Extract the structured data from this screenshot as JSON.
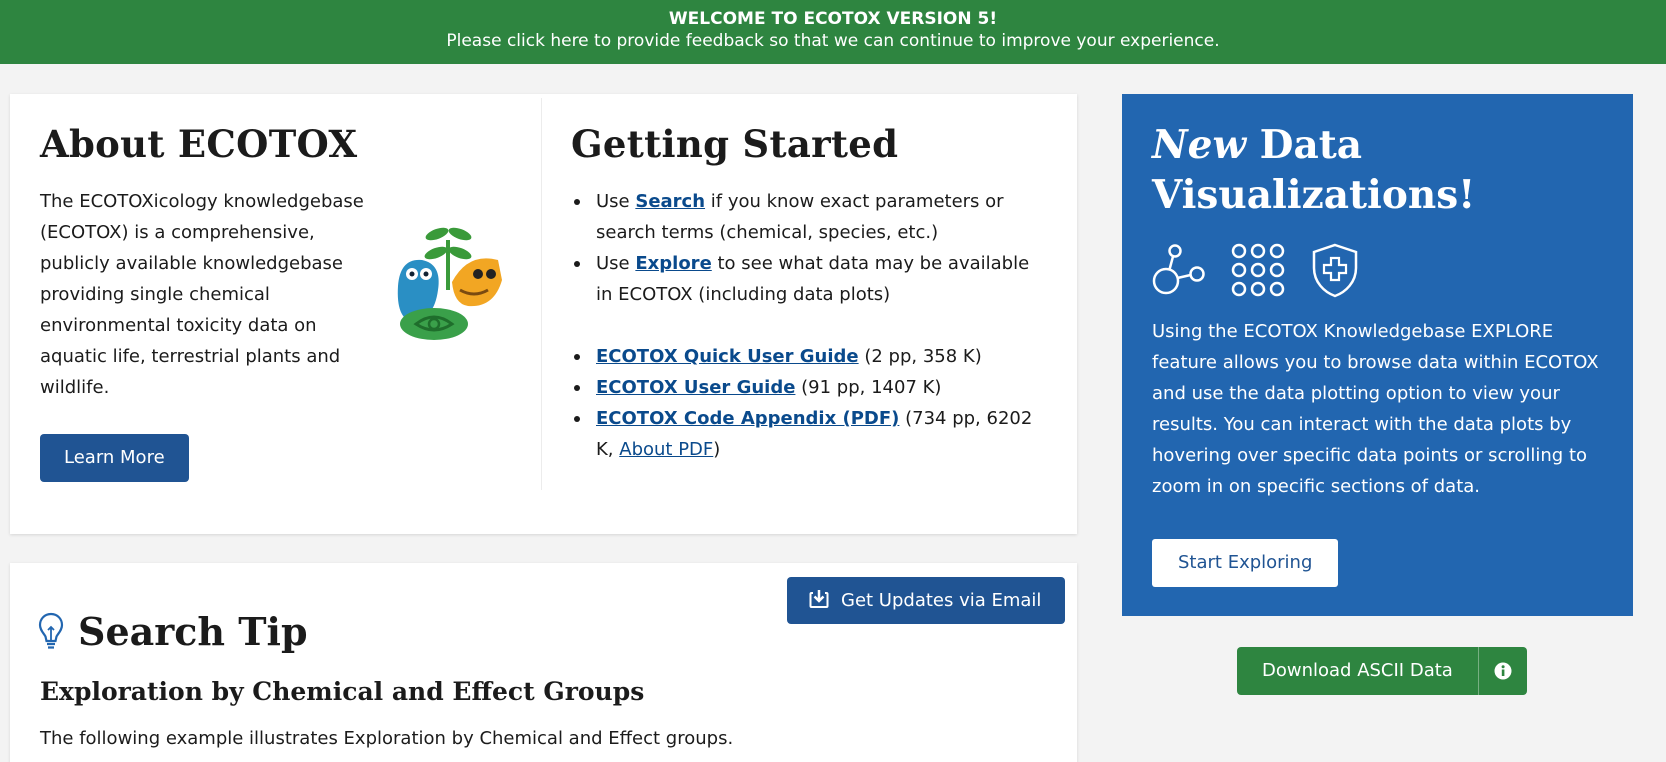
{
  "banner": {
    "line1": "WELCOME TO ECOTOX VERSION 5!",
    "line2": "Please click here to provide feedback so that we can continue to improve your experience."
  },
  "about": {
    "title": "About ECOTOX",
    "text": "The ECOTOXicology knowledgebase (ECOTOX) is a comprehensive, publicly available knowledgebase providing single chemical environmental toxicity data on aquatic life, terrestrial plants and wildlife.",
    "button": "Learn More"
  },
  "getting_started": {
    "title": "Getting Started",
    "items": [
      {
        "prefix": "Use ",
        "link": "Search",
        "suffix": " if you know exact parameters or search terms (chemical, species, etc.)"
      },
      {
        "prefix": "Use ",
        "link": "Explore",
        "suffix": " to see what data may be available in ECOTOX (including data plots)"
      }
    ],
    "guides": [
      {
        "link": "ECOTOX Quick User Guide",
        "detail": " (2 pp, 358 K)"
      },
      {
        "link": "ECOTOX User Guide",
        "detail": " (91 pp, 1407 K)"
      },
      {
        "link": "ECOTOX Code Appendix (PDF)",
        "detail": " (734 pp, 6202 K, ",
        "link2": "About PDF",
        "close": ")"
      }
    ]
  },
  "search_tip": {
    "title": "Search Tip",
    "subtitle": "Exploration by Chemical and Effect Groups",
    "text": "The following example illustrates Exploration by Chemical and Effect groups.",
    "updates_button": "Get Updates via Email"
  },
  "viz": {
    "title_em": "New",
    "title_rest": " Data",
    "title_line2": "Visualizations!",
    "icons": [
      "network-graph-icon",
      "dot-grid-icon",
      "shield-plus-icon"
    ],
    "text": "Using the ECOTOX Knowledgebase EXPLORE feature allows you to browse data within ECOTOX and use the data plotting option to view your results. You can interact with the data plots by hovering over specific data points or scrolling to zoom in on specific sections of data.",
    "button": "Start Exploring"
  },
  "download": {
    "button": "Download ASCII Data"
  },
  "colors": {
    "banner_green": "#2e8540",
    "primary_blue": "#205493",
    "viz_blue": "#2266b0",
    "link_blue": "#0a4a8c"
  }
}
